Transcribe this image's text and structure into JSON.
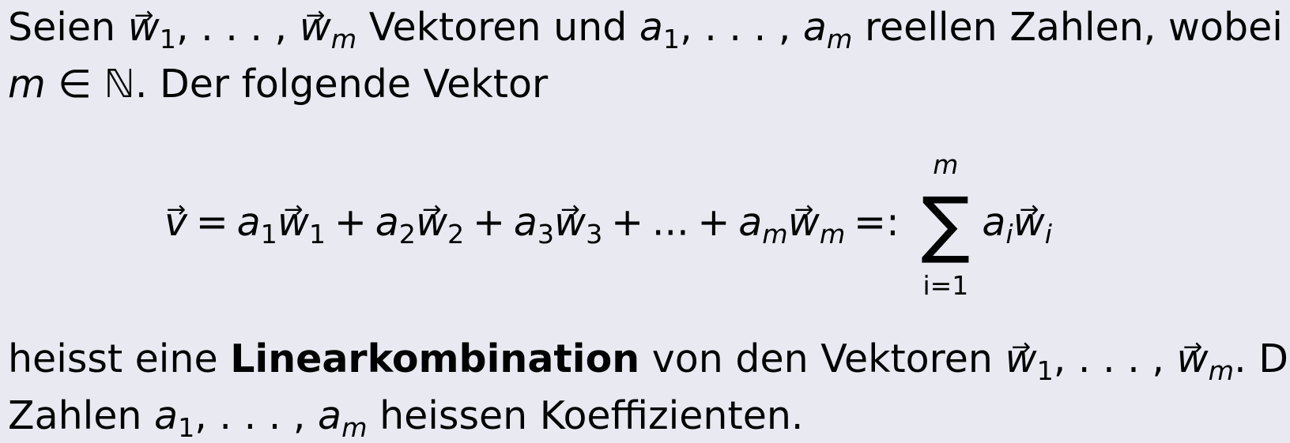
{
  "paragraph1": {
    "t1": "Seien ",
    "t2": " Vektoren und ",
    "t3": " reellen Zahlen, wobei",
    "t4": ". Der folgende Vektor"
  },
  "symbols": {
    "w": "w",
    "a": "a",
    "v": "v",
    "m": "m",
    "i": "i",
    "one": "1",
    "two": "2",
    "three": "3",
    "comma_dots": ", . . . , ",
    "in_naturals": " ∈ ℕ",
    "arrow": "→",
    "plus": "+",
    "equals": "=",
    "def_equals": "=:",
    "ellipsis": "...",
    "sum": "∑",
    "sum_upper": "m",
    "sum_lower": "i=1"
  },
  "paragraph2": {
    "t1": "heisst eine ",
    "bold": "Linearkombination",
    "t2": " von den Vektoren ",
    "t3": ". Die",
    "t4": "Zahlen ",
    "t5": " heissen Koeffizienten."
  }
}
